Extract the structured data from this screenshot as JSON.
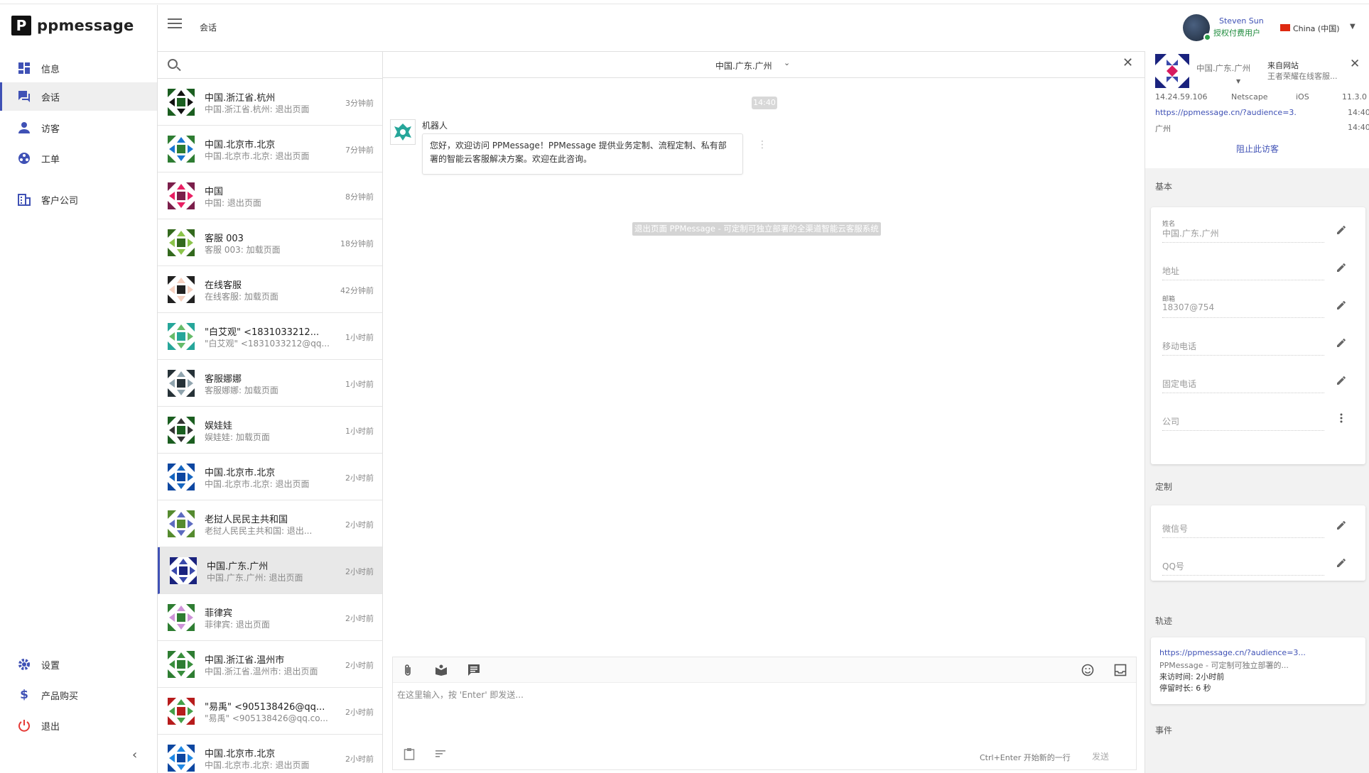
{
  "app": {
    "logo_letter": "P",
    "logo_text": "ppmessage"
  },
  "nav": {
    "items": [
      {
        "label": "信息",
        "icon": "dashboard-icon"
      },
      {
        "label": "会话",
        "icon": "chat-icon"
      },
      {
        "label": "访客",
        "icon": "person-icon"
      },
      {
        "label": "工单",
        "icon": "ticket-icon"
      },
      {
        "label": "客户公司",
        "icon": "building-icon"
      }
    ],
    "bottom": [
      {
        "label": "设置",
        "icon": "gear-icon"
      },
      {
        "label": "产品购买",
        "icon": "dollar-icon"
      },
      {
        "label": "退出",
        "icon": "power-icon"
      }
    ],
    "collapse_glyph": "‹"
  },
  "header": {
    "title": "会话",
    "user_name": "Steven Sun",
    "user_role": "授权付费用户",
    "language": "China (中国)"
  },
  "search": {
    "placeholder": ""
  },
  "conversations": [
    {
      "name": "中国.浙江省.杭州",
      "msg": "中国.浙江省.杭州: 退出页面",
      "time": "3分钟前",
      "c1": "#1b5e20",
      "c2": "#111111"
    },
    {
      "name": "中国.北京市.北京",
      "msg": "中国.北京市.北京: 退出页面",
      "time": "7分钟前",
      "c1": "#2e7d32",
      "c2": "#1976d2"
    },
    {
      "name": "中国",
      "msg": "中国: 退出页面",
      "time": "8分钟前",
      "c1": "#7b1f4b",
      "c2": "#e91e63"
    },
    {
      "name": "客服 003",
      "msg": "客服 003: 加载页面",
      "time": "18分钟前",
      "c1": "#33691e",
      "c2": "#8bc34a"
    },
    {
      "name": "在线客服",
      "msg": "在线客服: 加载页面",
      "time": "42分钟前",
      "c1": "#222222",
      "c2": "#f5d0c0"
    },
    {
      "name": "\"白艾观\" <1831033212...",
      "msg": "\"白艾观\" <1831033212@qq...",
      "time": "1小时前",
      "c1": "#26a69a",
      "c2": "#66bb6a"
    },
    {
      "name": "客服娜娜",
      "msg": "客服娜娜: 加载页面",
      "time": "1小时前",
      "c1": "#263238",
      "c2": "#90a4ae"
    },
    {
      "name": "娱娃娃",
      "msg": "娱娃娃: 加载页面",
      "time": "1小时前",
      "c1": "#1b5e20",
      "c2": "#333333"
    },
    {
      "name": "中国.北京市.北京",
      "msg": "中国.北京市.北京: 退出页面",
      "time": "2小时前",
      "c1": "#0d47a1",
      "c2": "#1565c0"
    },
    {
      "name": "老挝人民民主共和国",
      "msg": "老挝人民民主共和国: 退出...",
      "time": "2小时前",
      "c1": "#558b2f",
      "c2": "#5c6bc0"
    },
    {
      "name": "中国.广东.广州",
      "msg": "中国.广东.广州: 退出页面",
      "time": "2小时前",
      "c1": "#1a237e",
      "c2": "#3949ab",
      "active": true
    },
    {
      "name": "菲律宾",
      "msg": "菲律宾: 退出页面",
      "time": "2小时前",
      "c1": "#2e7d32",
      "c2": "#ce93d8"
    },
    {
      "name": "中国.浙江省.温州市",
      "msg": "中国.浙江省.温州市: 退出页面",
      "time": "2小时前",
      "c1": "#2e7d32",
      "c2": "#388e3c"
    },
    {
      "name": "\"易禹\" <905138426@qq...",
      "msg": "\"易禹\" <905138426@qq.co...",
      "time": "2小时前",
      "c1": "#b71c1c",
      "c2": "#43a047"
    },
    {
      "name": "中国.北京市.北京",
      "msg": "中国.北京市.北京: 退出页面",
      "time": "2小时前",
      "c1": "#0d47a1",
      "c2": "#1e88e5"
    }
  ],
  "chat": {
    "title": "中国.广东.广州",
    "time_chip": "14:40",
    "bot_name": "机器人",
    "bubble_line1": "您好，欢迎访问 PPMessage！PPMessage 提供业务定制、流程定制、私有部",
    "bubble_line2": "署的智能云客服解决方案。欢迎在此咨询。",
    "system_msg": "退出页面 PPMessage - 可定制可独立部署的全渠道智能云客服系统",
    "input_placeholder": "在这里输入，按 'Enter' 即发送...",
    "hint": "Ctrl+Enter 开始新的一行",
    "send": "发送",
    "tools": [
      "attach-icon",
      "book-icon",
      "message-icon",
      "emoji-icon",
      "inbox-icon",
      "clipboard-icon",
      "format-icon"
    ]
  },
  "visitor": {
    "location": "中国.广东.广州",
    "source_label": "来自网站",
    "source_value": "王者荣耀在线客服...",
    "ip": "14.24.59.106",
    "browser": "Netscape",
    "os": "iOS",
    "os_version": "11.3.0",
    "url": "https://ppmessage.cn/?audience=3...",
    "time1": "14:40",
    "city": "广州",
    "time2": "14:40",
    "block": "阻止此访客",
    "basic_title": "基本",
    "fields": [
      {
        "label": "姓名",
        "value": "中国.广东.广州",
        "action": "edit"
      },
      {
        "label": "",
        "value": "地址",
        "action": "edit"
      },
      {
        "label": "邮箱",
        "value": "18307@754",
        "action": "edit"
      },
      {
        "label": "",
        "value": "移动电话",
        "action": "edit"
      },
      {
        "label": "",
        "value": "固定电话",
        "action": "edit"
      },
      {
        "label": "",
        "value": "公司",
        "action": "more"
      }
    ],
    "custom_title": "定制",
    "custom_fields": [
      {
        "label": "",
        "value": "微信号"
      },
      {
        "label": "",
        "value": "QQ号"
      }
    ],
    "trail_title": "轨迹",
    "trail": {
      "url": "https://ppmessage.cn/?audience=3...",
      "desc": "PPMessage - 可定制可独立部署的...",
      "visit": "来访时间: 2小时前",
      "stay": "停留时长: 6 秒"
    },
    "events_title": "事件"
  },
  "colors": {
    "accent": "#3f51b5",
    "online": "#2e9e4a"
  }
}
